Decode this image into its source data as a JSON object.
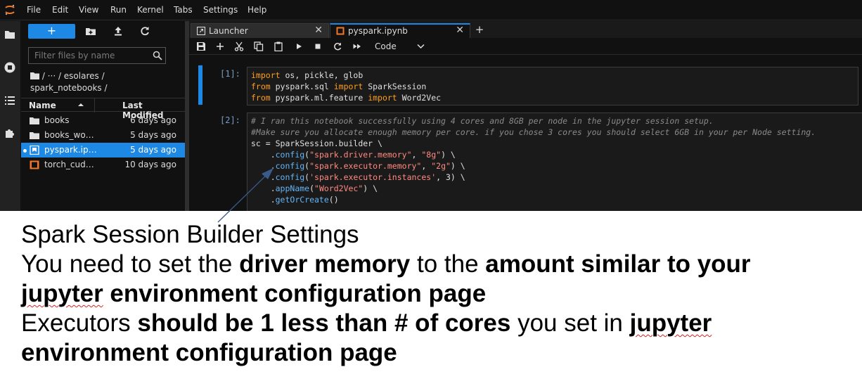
{
  "menubar": {
    "items": [
      "File",
      "Edit",
      "View",
      "Run",
      "Kernel",
      "Tabs",
      "Settings",
      "Help"
    ]
  },
  "activitybar": {
    "icons": [
      "folder-icon",
      "running-icon",
      "commands-icon",
      "extension-icon"
    ]
  },
  "filebrowser": {
    "new_label": "+",
    "filter_placeholder": "Filter files by name",
    "breadcrumb_line1": "/  ···  / esolares /",
    "breadcrumb_line2": "spark_notebooks /",
    "col_name": "Name",
    "col_modified": "Last Modified",
    "files": [
      {
        "name": "books",
        "modified": "6 days ago",
        "type": "folder"
      },
      {
        "name": "books_wo…",
        "modified": "5 days ago",
        "type": "folder"
      },
      {
        "name": "pyspark.ip…",
        "modified": "5 days ago",
        "type": "notebook",
        "selected": true
      },
      {
        "name": "torch_cud…",
        "modified": "10 days ago",
        "type": "notebook"
      }
    ]
  },
  "tabs": [
    {
      "label": "Launcher",
      "close": "✕"
    },
    {
      "label": "pyspark.ipynb",
      "close": "✕",
      "active": true
    }
  ],
  "tab_add": "+",
  "toolbar": {
    "cell_type": "Code"
  },
  "cells": [
    {
      "prompt": "[1]:",
      "lines": [
        "import os, pickle, glob",
        "from pyspark.sql import SparkSession",
        "from pyspark.ml.feature import Word2Vec"
      ]
    },
    {
      "prompt": "[2]:",
      "comment1": "# I ran this notebook successfully using 4 cores and 8GB per node in the jupyter session setup.",
      "comment2": "#Make sure you allocate enough memory per core. if you chose 3 cores you should select 6GB in your per Node setting.",
      "line_sc": "sc = SparkSession.builder \\",
      "config1_key": "\"spark.driver.memory\"",
      "config1_val": "\"8g\"",
      "config2_key": "\"spark.executor.memory\"",
      "config2_val": "\"2g\"",
      "config3_key": "'spark.executor.instances'",
      "config3_val": "3",
      "appname_val": "\"Word2Vec\""
    }
  ],
  "annotation": {
    "line1": "Spark Session Builder Settings",
    "line2_a": "You need to set the ",
    "line2_b": "driver memory",
    "line2_c": " to the ",
    "line2_d": "amount similar to your",
    "line3_a": "jupyter",
    "line3_b": " environment configuration page",
    "line4_a": "Executors ",
    "line4_b": "should be 1 less than # of cores",
    "line4_c": " you set in ",
    "line4_d": "jupyter",
    "line5": "environment configuration page"
  },
  "colors": {
    "accent": "#1e88e5",
    "keyword": "#ff9f1c",
    "string": "#ff8a80",
    "attribute": "#64b5f6",
    "arrow": "#3a5a8c"
  }
}
